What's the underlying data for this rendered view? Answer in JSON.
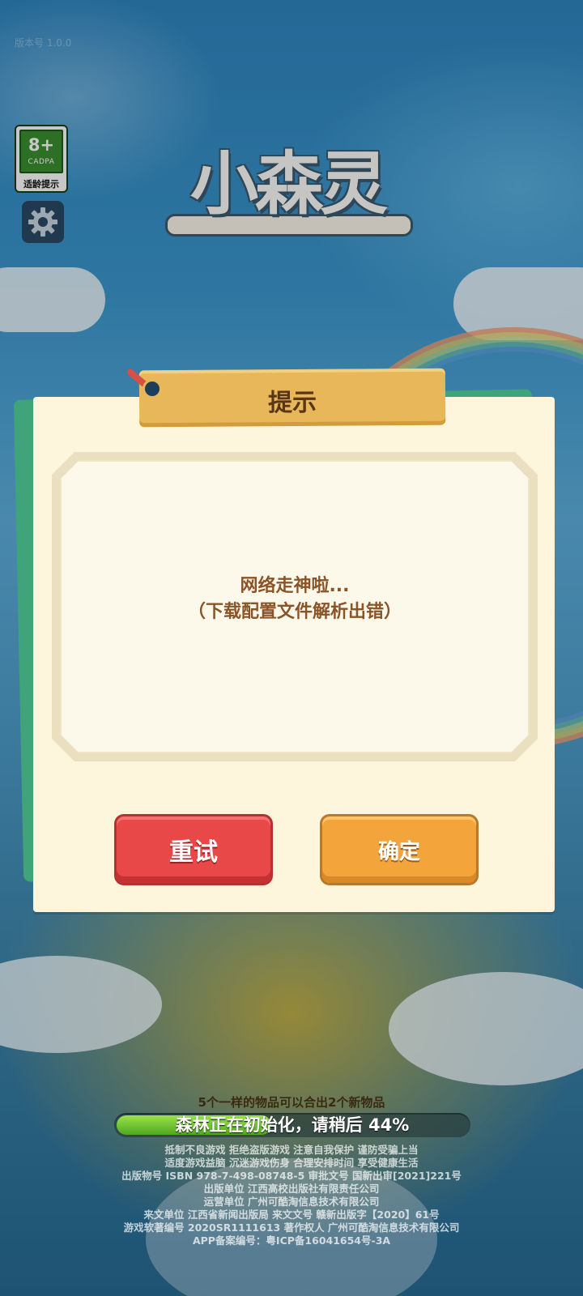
{
  "top_status": "版本号 1.0.0",
  "age_rating": {
    "age": "8+",
    "org": "CADPA",
    "label": "适龄提示"
  },
  "logo": {
    "title": "小森灵"
  },
  "dialog": {
    "title": "提示",
    "message_line1": "网络走神啦...",
    "message_line2": "（下载配置文件解析出错）",
    "retry_label": "重试",
    "confirm_label": "确定"
  },
  "loading": {
    "tip": "5个一样的物品可以合出2个新物品",
    "status": "森林正在初始化，请稍后 44%",
    "progress": 0.44
  },
  "legal": [
    "抵制不良游戏  拒绝盗版游戏  注意自我保护  谨防受骗上当",
    "适度游戏益脑  沉迷游戏伤身  合理安排时间  享受健康生活",
    "出版物号 ISBN 978-7-498-08748-5 审批文号 国新出审[2021]221号",
    "出版单位  江西高校出版社有限责任公司",
    "运营单位  广州可酷淘信息技术有限公司",
    "来文单位  江西省新闻出版局 来文文号  赣新出版字【2020】61号",
    "游戏软著编号  2020SR1111613 著作权人  广州可酷淘信息技术有限公司",
    "APP备案编号：粤ICP备16041654号-3A"
  ],
  "colors": {
    "dialog_bg": "#fdf6dc",
    "retry": "#e94848",
    "confirm": "#f3a43a",
    "title_tab": "#e7b75a",
    "message": "#8a5428"
  }
}
